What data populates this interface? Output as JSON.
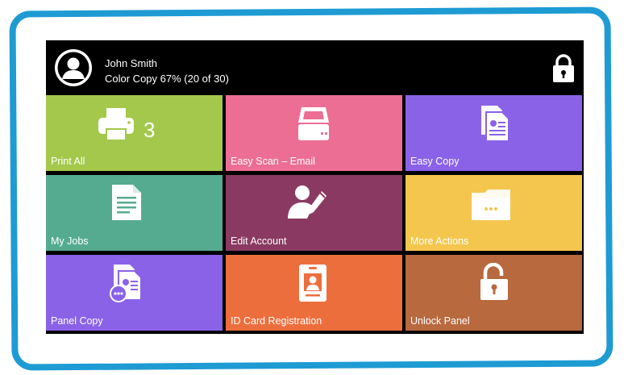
{
  "header": {
    "user_name": "John Smith",
    "status": "Color Copy 67%  (20 of 30)"
  },
  "tiles": [
    {
      "label": "Print All",
      "color": "#a3c84b",
      "icon": "printer-icon",
      "badge": "3"
    },
    {
      "label": "Easy Scan – Email",
      "color": "#ec6e95",
      "icon": "scanner-icon"
    },
    {
      "label": "Easy Copy",
      "color": "#8a62e8",
      "icon": "copy-document-icon"
    },
    {
      "label": "My Jobs",
      "color": "#54ab90",
      "icon": "document-icon"
    },
    {
      "label": "Edit Account",
      "color": "#8a3a62",
      "icon": "user-edit-icon"
    },
    {
      "label": "More Actions",
      "color": "#f4c64e",
      "icon": "folder-icon"
    },
    {
      "label": "Panel Copy",
      "color": "#8a62e8",
      "icon": "panel-copy-icon"
    },
    {
      "label": "ID Card Registration",
      "color": "#ec6e3d",
      "icon": "id-card-icon"
    },
    {
      "label": "Unlock Panel",
      "color": "#b8693e",
      "icon": "unlock-icon"
    }
  ],
  "colors": {
    "frame": "#1e9bd3",
    "header_bg": "#000000"
  }
}
